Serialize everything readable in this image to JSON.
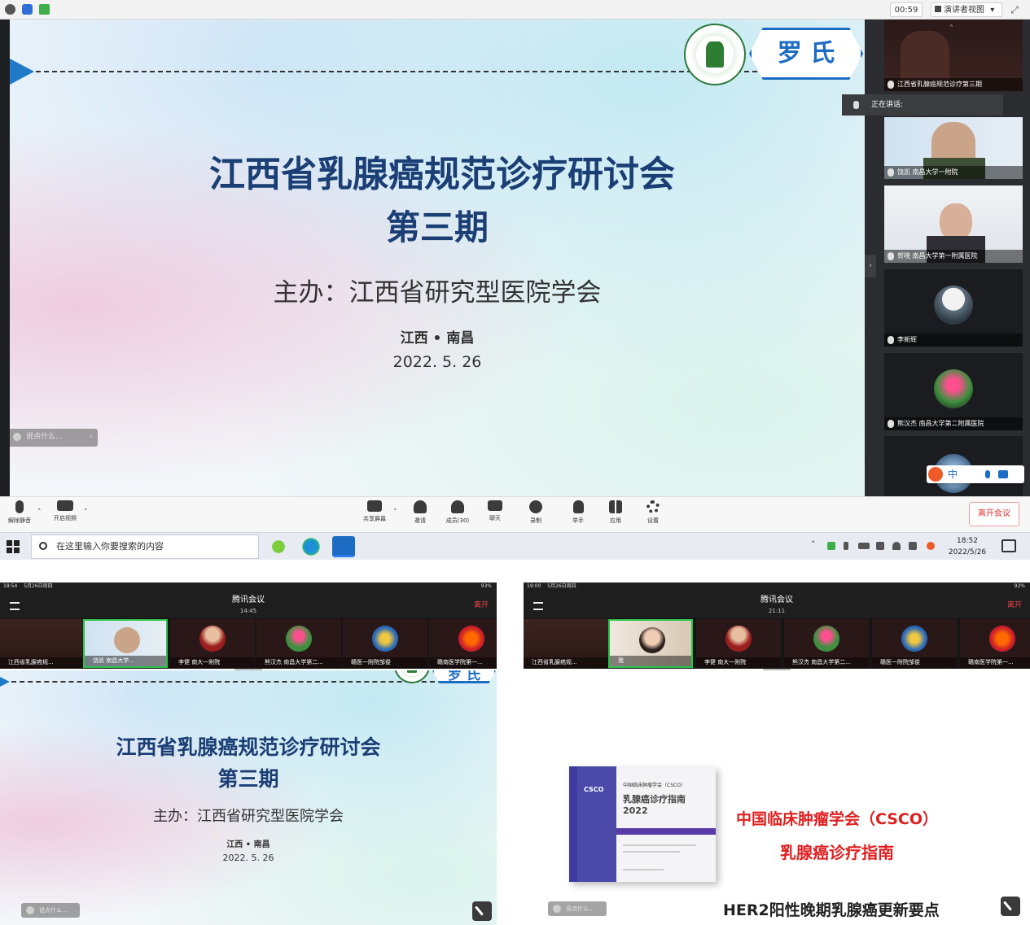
{
  "top": {
    "titlebar": {
      "timer": "00:59",
      "view_mode": "演讲者视图",
      "view_mode_arrow": "▾"
    },
    "slide": {
      "title_line1": "江西省乳腺癌规范诊疗研讨会",
      "title_line2": "第三期",
      "host": "主办：江西省研究型医院学会",
      "location": "江西 • 南昌",
      "date": "2022. 5. 26",
      "brand_badge": "罗 氏",
      "chat_placeholder": "说点什么..."
    },
    "panel": {
      "speaking_label": "正在讲话:",
      "participants": [
        {
          "name": "江西省乳腺癌规范诊疗第三期"
        },
        {
          "name": "饶凯 南昌大学一附院"
        },
        {
          "name": "贺晓 南昌大学第一附属医院"
        },
        {
          "name": "李新辉"
        },
        {
          "name": "熊汉杰 南昌大学第二附属医院"
        }
      ]
    },
    "toolbar": {
      "unmute": "解除静音",
      "start_video": "开启视频",
      "share_screen": "共享屏幕",
      "invite": "邀请",
      "members": "成员(30)",
      "chat": "聊天",
      "record": "录制",
      "raise_hand": "举手",
      "apps": "应用",
      "settings": "设置",
      "leave": "离开会议"
    },
    "taskbar": {
      "search_placeholder": "在这里输入你要搜索的内容",
      "time": "18:52",
      "date": "2022/5/26",
      "ime": "中"
    }
  },
  "phone_left": {
    "status_time": "18:54",
    "status_date": "5月26日周四",
    "battery": "93%",
    "app_name": "腾讯会议",
    "duration": "14:45",
    "leave": "离开",
    "participants": [
      {
        "name": "江西省乳腺癌规..."
      },
      {
        "name": "饶凯 南昌大学..."
      },
      {
        "name": "李健 南大一附院"
      },
      {
        "name": "熊汉杰 南昌大学第二..."
      },
      {
        "name": "赣医一附院邹俊"
      },
      {
        "name": "赣南医学院第一..."
      }
    ],
    "slide": {
      "title_line1": "江西省乳腺癌规范诊疗研讨会",
      "title_line2": "第三期",
      "host": "主办：江西省研究型医院学会",
      "location": "江西 • 南昌",
      "date": "2022. 5. 26",
      "brand_badge": "罗 氏",
      "chat_placeholder": "说点什么..."
    }
  },
  "phone_right": {
    "status_time": "19:00",
    "status_date": "5月26日周四",
    "battery": "92%",
    "app_name": "腾讯会议",
    "duration": "21:11",
    "leave": "离开",
    "participants": [
      {
        "name": "江西省乳腺癌规..."
      },
      {
        "name": "我"
      },
      {
        "name": "李健 南大一附院"
      },
      {
        "name": "熊汉杰 南昌大学第二..."
      },
      {
        "name": "赣医一附院邹俊"
      },
      {
        "name": "赣南医学院第一..."
      }
    ],
    "slide": {
      "title_line1": "中国临床肿瘤学会（CSCO）",
      "title_line2": "乳腺癌诊疗指南",
      "subtitle": "HER2阳性晚期乳腺癌更新要点",
      "book_logo": "CSCO",
      "book_header": "中国临床肿瘤学会（CSCO）",
      "book_title": "乳腺癌诊疗指南",
      "book_year": "2022",
      "chat_placeholder": "说点什么..."
    }
  }
}
